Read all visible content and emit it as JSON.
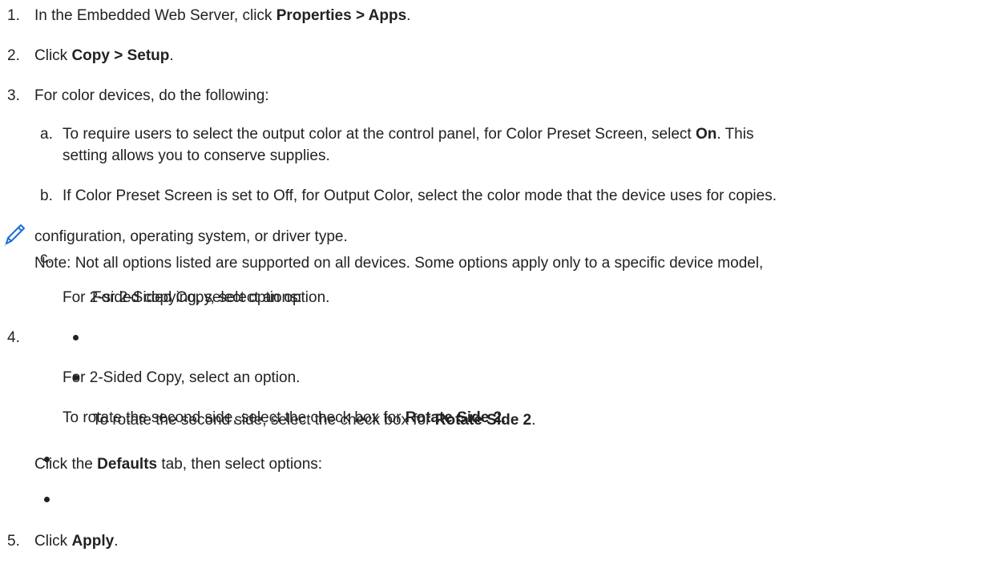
{
  "steps": [
    {
      "number": "1.",
      "parts": [
        "In the Embedded Web Server, click ",
        "Properties > Apps",
        "."
      ]
    },
    {
      "number": "2.",
      "parts": [
        "Click ",
        "Copy > Setup",
        "."
      ]
    },
    {
      "number": "3.",
      "text": "For color devices, do the following:",
      "substeps": [
        {
          "letter": "a.",
          "line1_parts": [
            "To require users to select the output color at the control panel, for Color Preset Screen, select ",
            "On",
            ". This"
          ],
          "line2": "setting allows you to conserve supplies."
        },
        {
          "letter": "b.",
          "text": "If Color Preset Screen is set to Off, for Output Color, select the color mode that the device uses for copies."
        },
        {
          "letter": "c.",
          "text": "For 2-sided copying, select options:",
          "bullets": [
            {
              "text": "For 2-Sided Copy, select an option."
            },
            {
              "parts": [
                "To rotate the second side, select the check box for ",
                "Rotate Side 2",
                "."
              ]
            }
          ]
        }
      ]
    },
    {
      "number": "4.",
      "parts": [
        "Click the ",
        "Defaults",
        " tab, then select options:"
      ],
      "bullets": [
        {
          "text": "For 2-Sided Copy, select an option."
        },
        {
          "parts": [
            "To rotate the second side, select the check box for ",
            "Rotate Side 2",
            "."
          ]
        }
      ]
    },
    {
      "number": "5.",
      "parts": [
        "Click ",
        "Apply",
        "."
      ]
    }
  ],
  "note": {
    "icon": "pencil-icon",
    "line1": "Note: Not all options listed are supported on all devices. Some options apply only to a specific device model,",
    "line2": "configuration, operating system, or driver type."
  },
  "colors": {
    "text": "#222222",
    "icon": "#1c6fd6"
  }
}
